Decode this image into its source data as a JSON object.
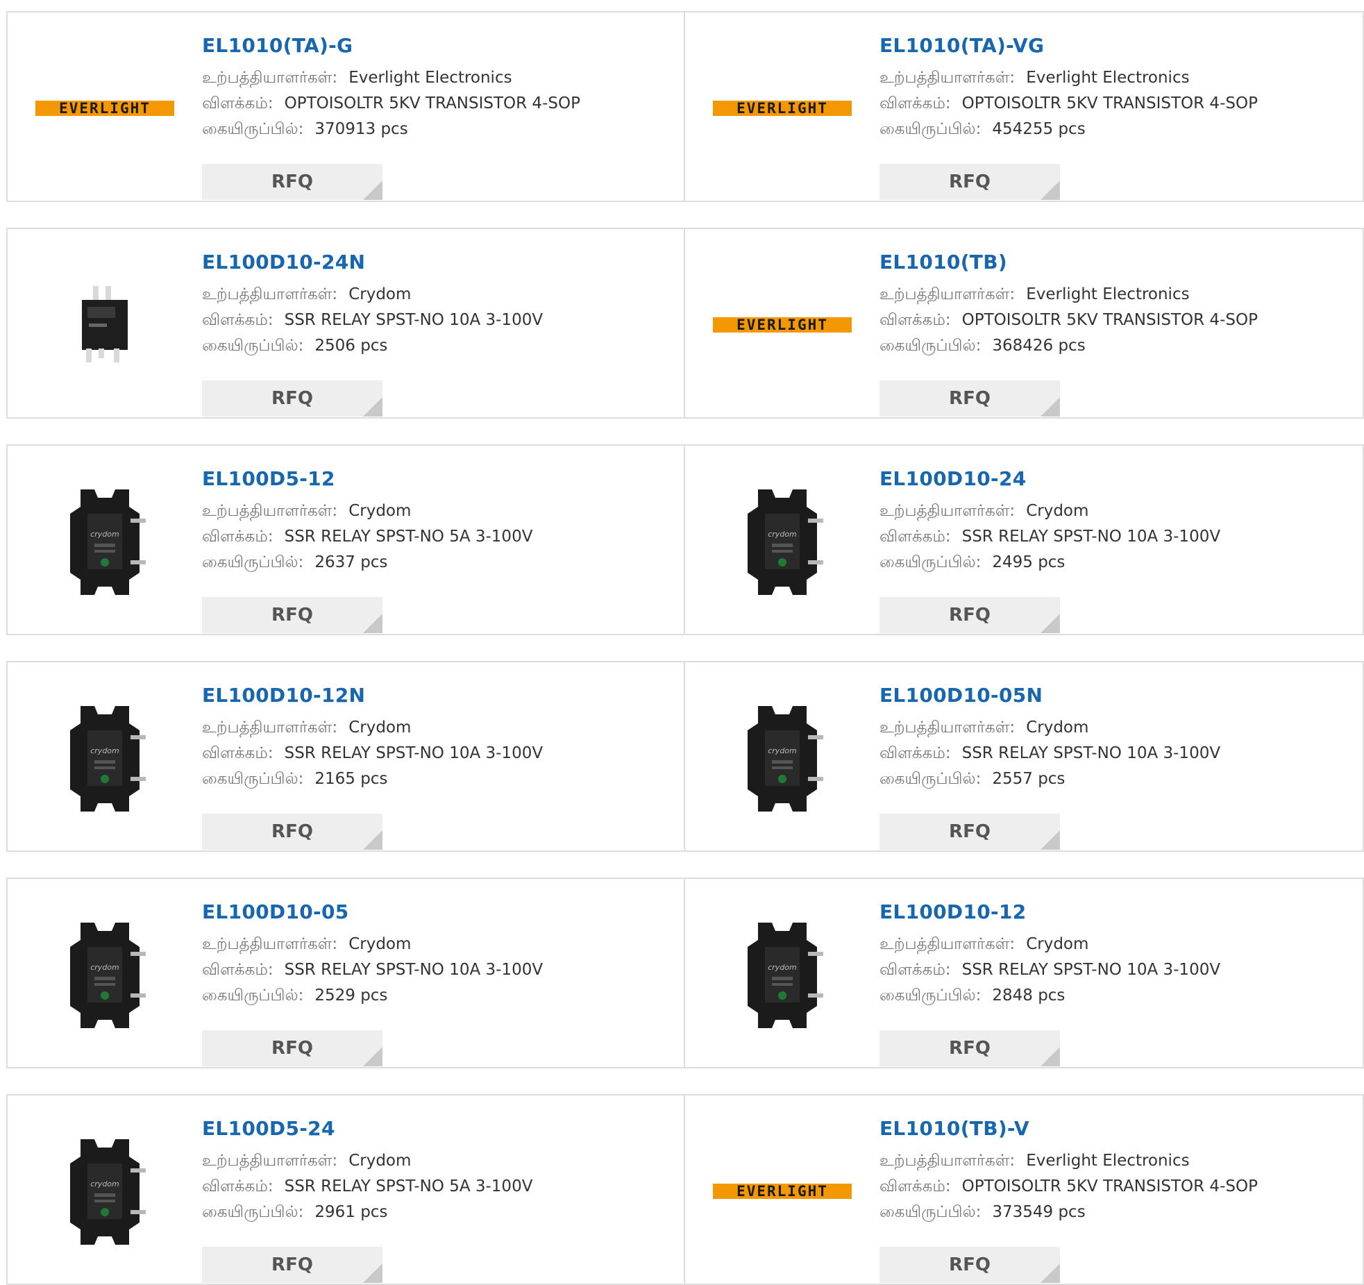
{
  "labels": {
    "manufacturer": "உற்பத்தியாளர்கள்:",
    "description": "விளக்கம்:",
    "stock": "கையிருப்பில்:",
    "rfq": "RFQ"
  },
  "colors": {
    "title": "#1766b0",
    "everlight_logo": "#f39800",
    "rfq_bg": "#eeeeee"
  },
  "products": [
    {
      "part": "EL1010(TA)-G",
      "manufacturer": "Everlight Electronics",
      "description": "OPTOISOLTR 5KV TRANSISTOR 4-SOP",
      "stock": "370913 pcs",
      "image": "everlight-logo",
      "logo_text": "EVERLIGHT"
    },
    {
      "part": "EL1010(TA)-VG",
      "manufacturer": "Everlight Electronics",
      "description": "OPTOISOLTR 5KV TRANSISTOR 4-SOP",
      "stock": "454255 pcs",
      "image": "everlight-logo",
      "logo_text": "EVERLIGHT"
    },
    {
      "part": "EL100D10-24N",
      "manufacturer": "Crydom",
      "description": "SSR RELAY SPST-NO 10A 3-100V",
      "stock": "2506 pcs",
      "image": "small-relay-photo"
    },
    {
      "part": "EL1010(TB)",
      "manufacturer": "Everlight Electronics",
      "description": "OPTOISOLTR 5KV TRANSISTOR 4-SOP",
      "stock": "368426 pcs",
      "image": "everlight-logo",
      "logo_text": "EVERLIGHT"
    },
    {
      "part": "EL100D5-12",
      "manufacturer": "Crydom",
      "description": "SSR RELAY SPST-NO 5A 3-100V",
      "stock": "2637 pcs",
      "image": "crydom-relay-photo"
    },
    {
      "part": "EL100D10-24",
      "manufacturer": "Crydom",
      "description": "SSR RELAY SPST-NO 10A 3-100V",
      "stock": "2495 pcs",
      "image": "crydom-relay-photo"
    },
    {
      "part": "EL100D10-12N",
      "manufacturer": "Crydom",
      "description": "SSR RELAY SPST-NO 10A 3-100V",
      "stock": "2165 pcs",
      "image": "crydom-relay-photo"
    },
    {
      "part": "EL100D10-05N",
      "manufacturer": "Crydom",
      "description": "SSR RELAY SPST-NO 10A 3-100V",
      "stock": "2557 pcs",
      "image": "crydom-relay-photo"
    },
    {
      "part": "EL100D10-05",
      "manufacturer": "Crydom",
      "description": "SSR RELAY SPST-NO 10A 3-100V",
      "stock": "2529 pcs",
      "image": "crydom-relay-photo"
    },
    {
      "part": "EL100D10-12",
      "manufacturer": "Crydom",
      "description": "SSR RELAY SPST-NO 10A 3-100V",
      "stock": "2848 pcs",
      "image": "crydom-relay-photo"
    },
    {
      "part": "EL100D5-24",
      "manufacturer": "Crydom",
      "description": "SSR RELAY SPST-NO 5A 3-100V",
      "stock": "2961 pcs",
      "image": "crydom-relay-photo"
    },
    {
      "part": "EL1010(TB)-V",
      "manufacturer": "Everlight Electronics",
      "description": "OPTOISOLTR 5KV TRANSISTOR 4-SOP",
      "stock": "373549 pcs",
      "image": "everlight-logo",
      "logo_text": "EVERLIGHT"
    }
  ]
}
